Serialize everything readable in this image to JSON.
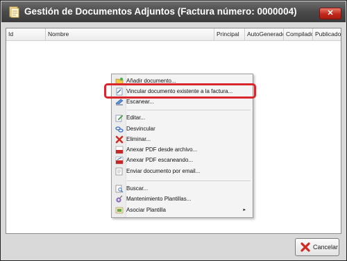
{
  "window": {
    "title": "Gestión de Documentos Adjuntos (Factura número: 0000004)",
    "close_label": "✕"
  },
  "grid": {
    "columns": [
      "Id",
      "Nombre",
      "Principal",
      "AutoGenerado",
      "Compilado",
      "Publicado"
    ]
  },
  "context_menu": {
    "items": [
      {
        "label": "Añadir documento...",
        "icon": "folder-add-icon"
      },
      {
        "label": "Vincular documento existente a la factura...",
        "icon": "link-document-icon"
      },
      {
        "label": "Escanear...",
        "icon": "scanner-icon"
      },
      {
        "label": "Editar...",
        "icon": "edit-icon"
      },
      {
        "label": "Desvincular",
        "icon": "unlink-icon"
      },
      {
        "label": "Eliminar...",
        "icon": "delete-icon"
      },
      {
        "label": "Anexar PDF desde archivo...",
        "icon": "pdf-file-icon"
      },
      {
        "label": "Anexar PDF escaneando...",
        "icon": "pdf-scan-icon"
      },
      {
        "label": "Enviar documento por email...",
        "icon": "email-icon"
      },
      {
        "label": "Buscar...",
        "icon": "search-icon"
      },
      {
        "label": "Mantenimiento Plantillas...",
        "icon": "templates-icon"
      },
      {
        "label": "Asociar Plantilla",
        "icon": "associate-template-icon",
        "submenu_arrow": "▸"
      }
    ],
    "highlighted_item": "Vincular documento existente a la factura...",
    "highlight_color": "#d8262c"
  },
  "footer": {
    "cancel_label": "Cancelar"
  }
}
